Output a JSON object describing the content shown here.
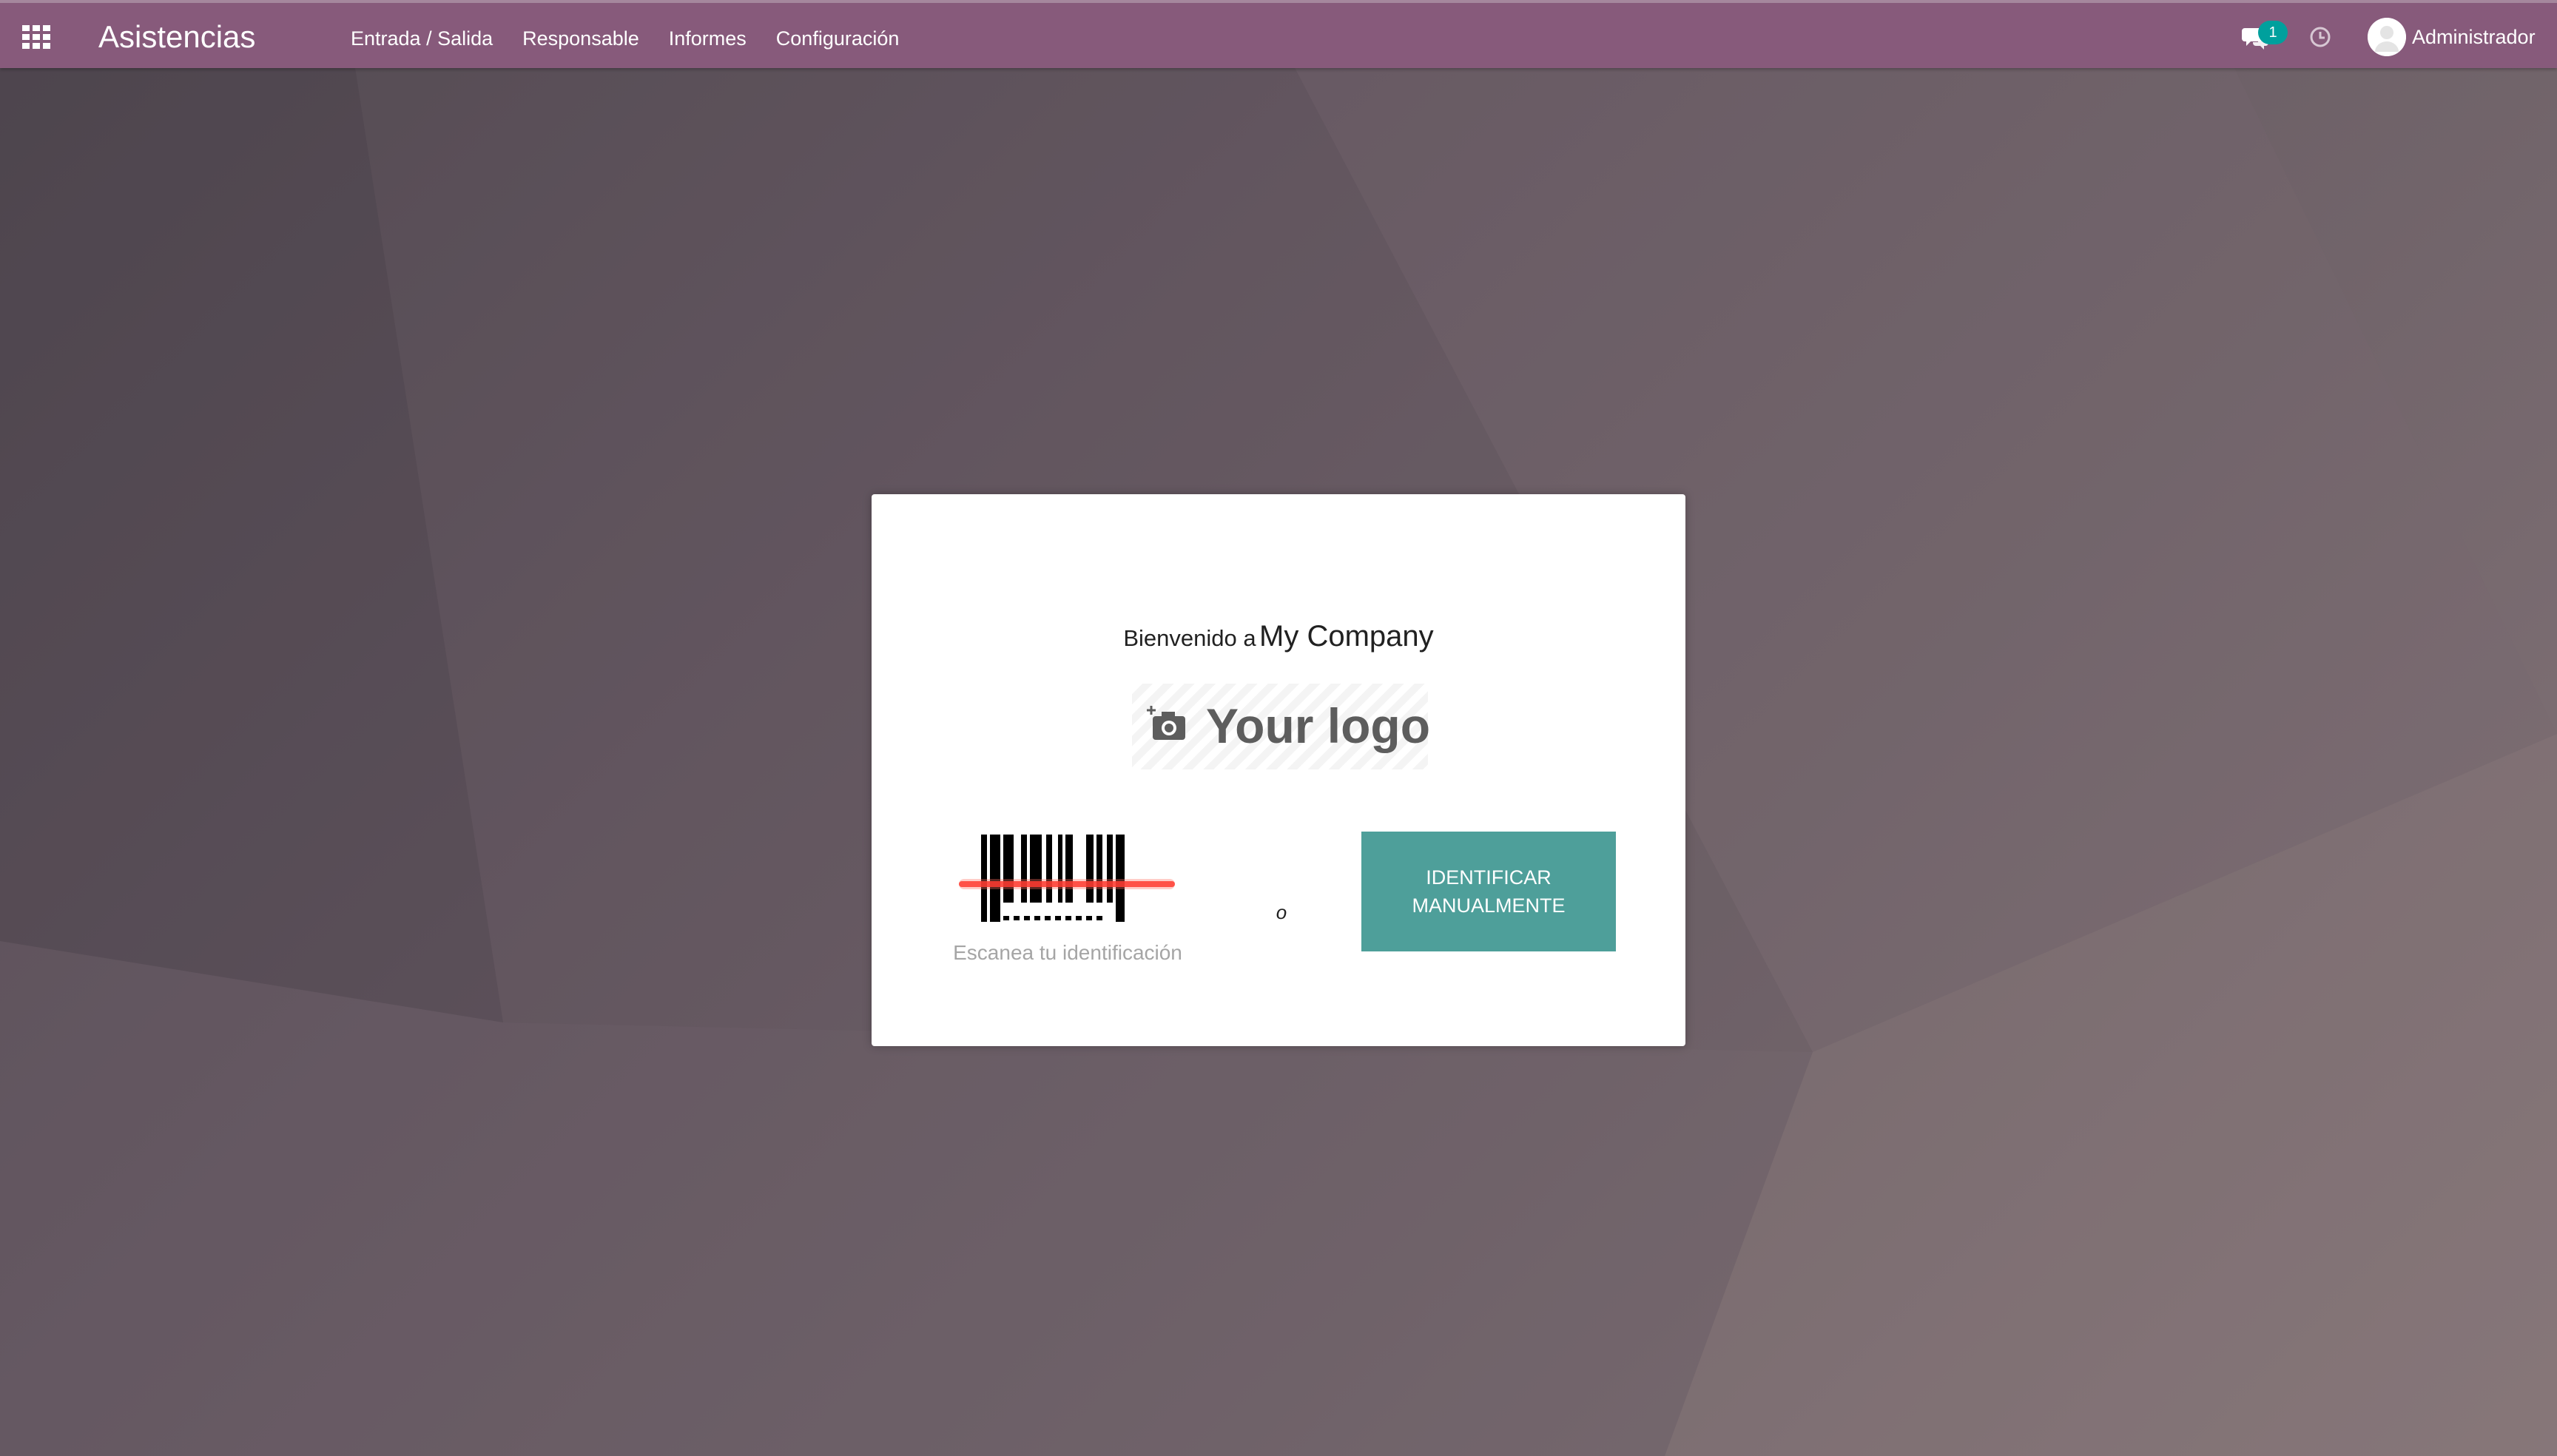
{
  "app": {
    "title": "Asistencias"
  },
  "navbar": {
    "apps_icon": "grid-icon",
    "menu": [
      {
        "label": "Entrada / Salida"
      },
      {
        "label": "Responsable"
      },
      {
        "label": "Informes"
      },
      {
        "label": "Configuración"
      }
    ],
    "systray": {
      "chat_icon": "chat-bubbles-icon",
      "chat_count": "1",
      "activity_icon": "clock-icon",
      "user_name": "Administrador"
    }
  },
  "kiosk": {
    "welcome_prefix": "Bienvenido a",
    "company_name": "My Company",
    "logo_placeholder": "Your logo",
    "logo_icon": "camera-plus-icon",
    "barcode_icon": "barcode-scanner-icon",
    "scan_label": "Escanea tu identificación",
    "or_label": "o",
    "identify_button": "IDENTIFICAR MANUALMENTE"
  },
  "colors": {
    "navbar": "#875a7b",
    "accent_button": "#4e9f9a",
    "badge": "#00a09d",
    "scan_line": "#ff3b30"
  }
}
